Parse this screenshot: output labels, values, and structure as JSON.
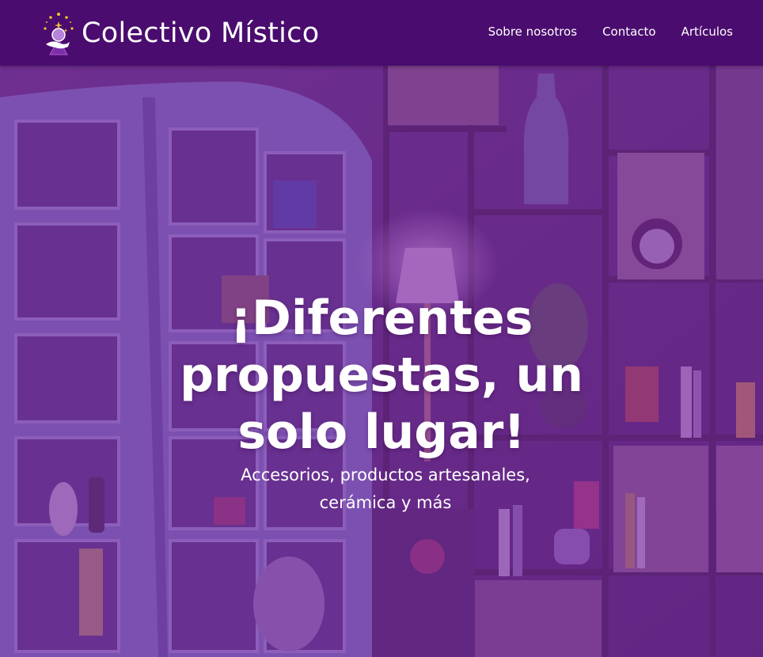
{
  "navbar": {
    "brand_name": "Colectivo Místico",
    "logo_icon": "crystal-ball-hand-icon",
    "links": [
      "Sobre nosotros",
      "Contacto",
      "Artículos"
    ]
  },
  "hero": {
    "title_lines": [
      "¡Diferentes",
      "propuestas, un",
      "solo lugar!"
    ],
    "subtitle_lines": [
      "Accesorios, productos artesanales,",
      "cerámica y más"
    ]
  },
  "colors": {
    "navbar_bg": "#4a0c6e",
    "overlay": "#7a2a9e",
    "text": "#ffffff",
    "logo_star": "#f2c230"
  }
}
